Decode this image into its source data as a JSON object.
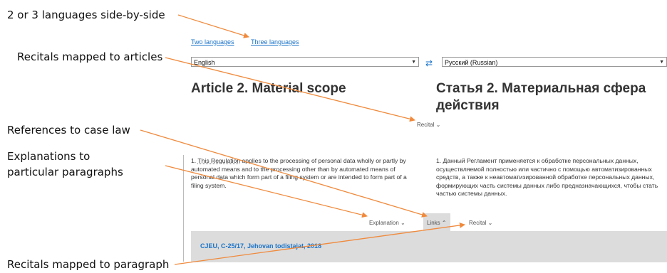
{
  "annotations": {
    "side_by_side": "2 or 3 languages side-by-side",
    "recitals_articles": "Recitals mapped to articles",
    "case_law": "References to case law",
    "explanations_line1": "Explanations to",
    "explanations_line2": "particular paragraphs",
    "recitals_paragraph": "Recitals mapped to paragraph"
  },
  "language_links": {
    "two": "Two languages",
    "three": "Three languages"
  },
  "selects": {
    "left": "English",
    "right": "Русский (Russian)"
  },
  "icons": {
    "swap": "swap-arrows-icon",
    "caret": "caret-down-icon",
    "chevron": "chevron-down-icon"
  },
  "article": {
    "title_en": "Article 2. Material scope",
    "title_ru_line1": "Статья 2. Материальная сфера",
    "title_ru_line2": "действия",
    "recital_toggle": "Recital ⌄",
    "para_en_linked": "This Regulation",
    "para_en_prefix": "1. ",
    "para_en_rest": " applies to the processing of personal data wholly or partly by automated means and to the processing other than by automated means of personal data which form part of a filing system or are intended to form part of a filing system.",
    "para_ru": "1. Данный Регламент применяется к обработке персональных данных, осуществляемой полностью или частично с помощью автоматизированных средств, а также к неавтоматизированной обработке персональных данных, формирующих часть системы данных либо предназначающихся, чтобы стать частью системы данных."
  },
  "tabs": {
    "explanation": "Explanation ⌄",
    "links": "Links ⌃",
    "recital": "Recital ⌄"
  },
  "case_law": {
    "item": "CJEU, C-25/17, Jehovan todistajat, 2018"
  },
  "colors": {
    "link": "#1a73c8",
    "arrow": "#f08a3c",
    "panel": "#dcdcdc"
  }
}
